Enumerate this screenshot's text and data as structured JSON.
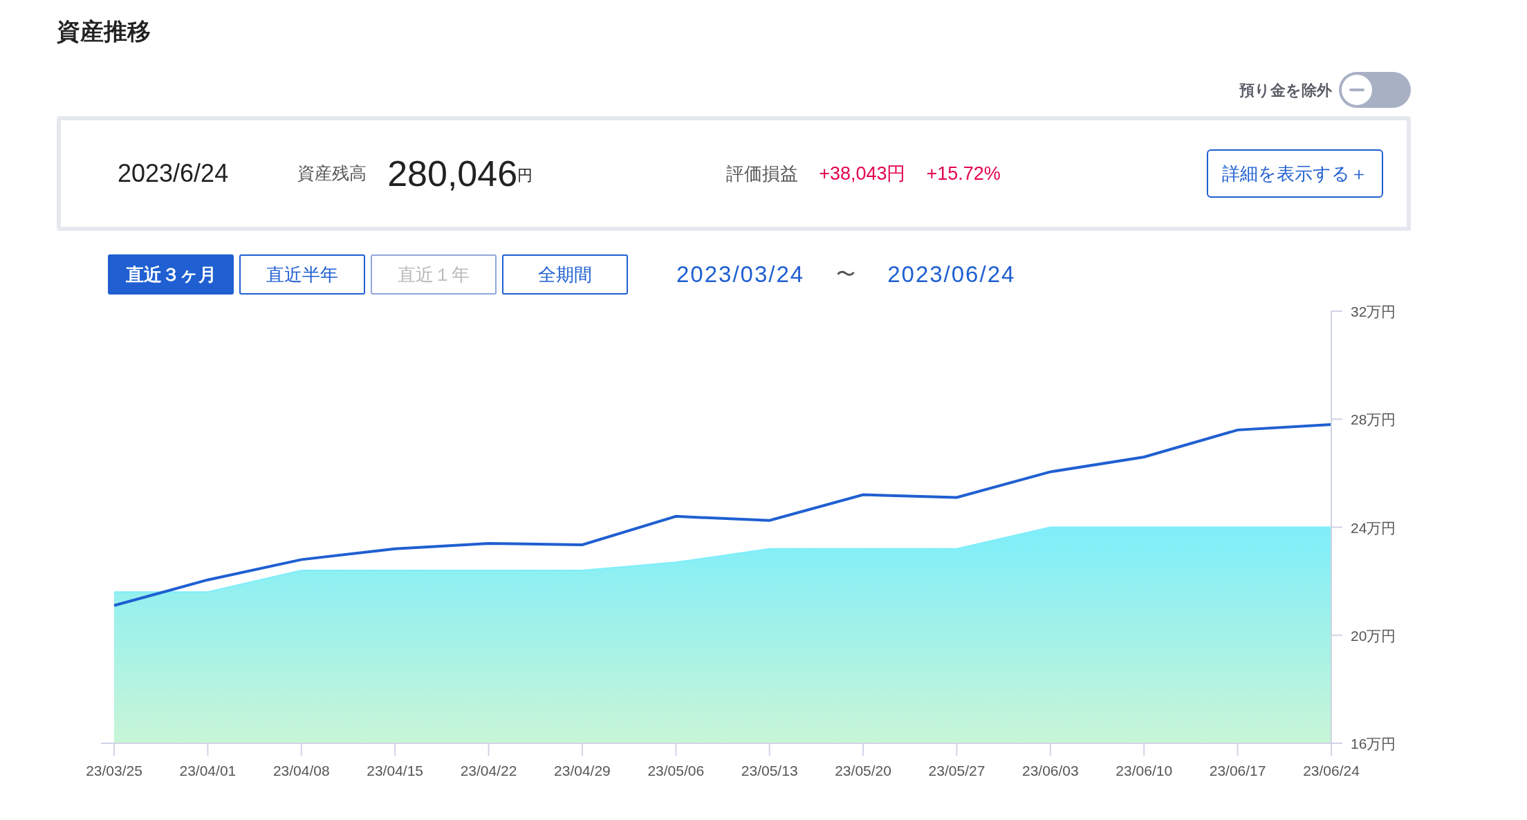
{
  "title": "資産推移",
  "toggle": {
    "label": "預り金を除外",
    "on": false
  },
  "summary": {
    "date": "2023/6/24",
    "balance_label": "資産残高",
    "balance": "280,046",
    "balance_unit": "円",
    "pl_label": "評価損益",
    "pl_amount": "+38,043円",
    "pl_percent": "+15.72%",
    "detail_button": "詳細を表示する＋"
  },
  "periods": [
    {
      "label": "直近３ヶ月",
      "selected": true,
      "disabled": false
    },
    {
      "label": "直近半年",
      "selected": false,
      "disabled": false
    },
    {
      "label": "直近１年",
      "selected": false,
      "disabled": true
    },
    {
      "label": "全期間",
      "selected": false,
      "disabled": false
    }
  ],
  "range": {
    "from": "2023/03/24",
    "separator": "〜",
    "to": "2023/06/24"
  },
  "chart": {
    "chart_data": {
      "type": "area",
      "categories": [
        "23/03/25",
        "23/04/01",
        "23/04/08",
        "23/04/15",
        "23/04/22",
        "23/04/29",
        "23/05/06",
        "23/05/13",
        "23/05/20",
        "23/05/27",
        "23/06/03",
        "23/06/10",
        "23/06/17",
        "23/06/24"
      ],
      "series": [
        {
          "color": "#7eeefa",
          "values": [
            21.6,
            21.6,
            22.4,
            22.4,
            22.4,
            22.4,
            22.7,
            23.2,
            23.2,
            23.2,
            24.0,
            24.0,
            24.0,
            24.0
          ]
        },
        {
          "type": "line",
          "color": "#1f5fd1",
          "values": [
            21.1,
            22.05,
            22.8,
            23.2,
            23.4,
            23.35,
            24.4,
            24.25,
            25.2,
            25.1,
            26.05,
            26.6,
            27.6,
            27.8
          ]
        }
      ],
      "ylim": [
        16,
        32
      ],
      "yticks": [
        {
          "value": 16,
          "label": "16万円"
        },
        {
          "value": 20,
          "label": "20万円"
        },
        {
          "value": 24,
          "label": "24万円"
        },
        {
          "value": 28,
          "label": "28万円"
        },
        {
          "value": 32,
          "label": "32万円"
        }
      ]
    }
  }
}
